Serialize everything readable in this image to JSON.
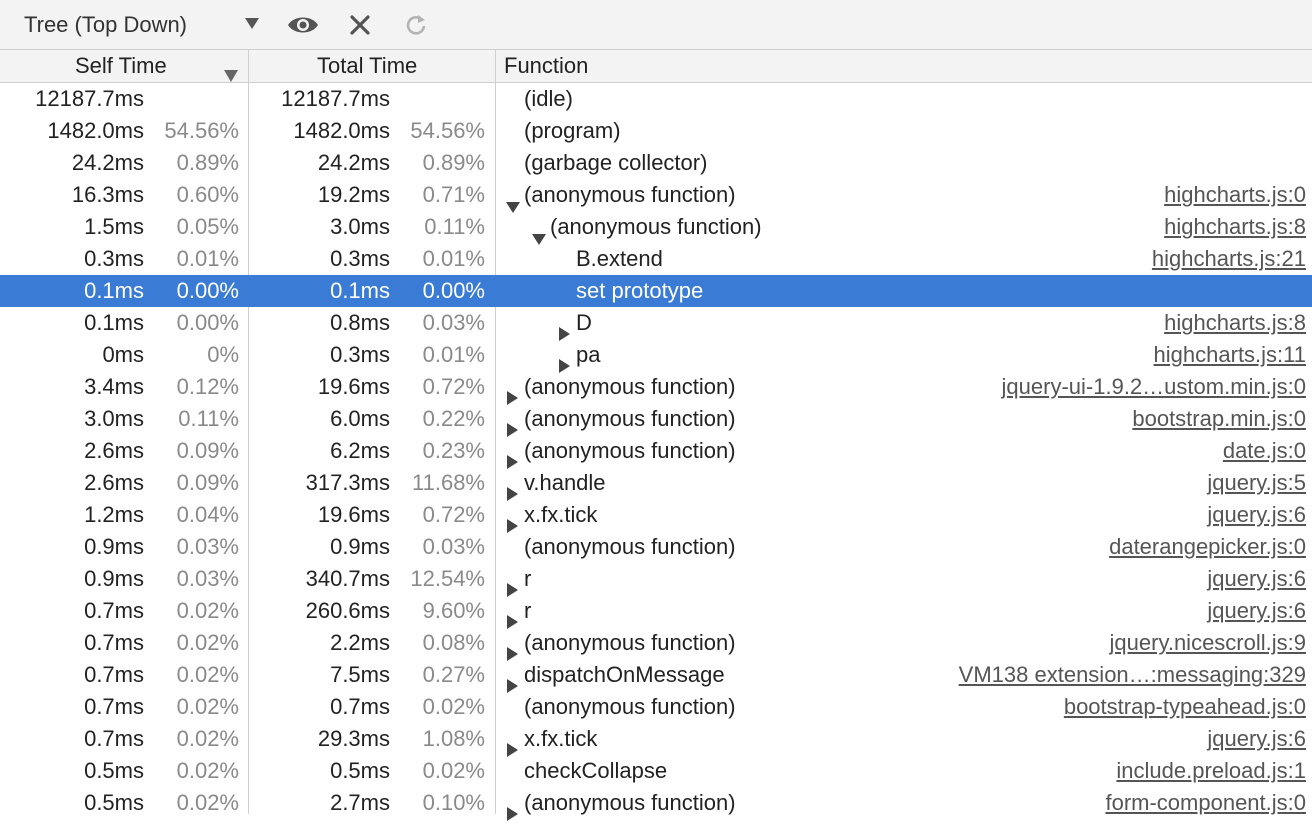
{
  "toolbar": {
    "view_mode": "Tree (Top Down)",
    "icons": [
      "chevron-down-icon",
      "eye-icon",
      "close-icon",
      "reload-icon"
    ]
  },
  "columns": {
    "self_time": "Self Time",
    "total_time": "Total Time",
    "function": "Function"
  },
  "colors": {
    "selection": "#3a7bd5",
    "percent_text": "#8a8a8a",
    "toolbar_bg": "#f3f3f3",
    "divider": "#cfcfcf"
  },
  "rows": [
    {
      "self": "12187.7ms",
      "self_pct": "",
      "total": "12187.7ms",
      "total_pct": "",
      "depth": 0,
      "toggle": "none",
      "name": "(idle)",
      "url": ""
    },
    {
      "self": "1482.0ms",
      "self_pct": "54.56%",
      "total": "1482.0ms",
      "total_pct": "54.56%",
      "depth": 0,
      "toggle": "none",
      "name": "(program)",
      "url": ""
    },
    {
      "self": "24.2ms",
      "self_pct": "0.89%",
      "total": "24.2ms",
      "total_pct": "0.89%",
      "depth": 0,
      "toggle": "none",
      "name": "(garbage collector)",
      "url": ""
    },
    {
      "self": "16.3ms",
      "self_pct": "0.60%",
      "total": "19.2ms",
      "total_pct": "0.71%",
      "depth": 0,
      "toggle": "expanded",
      "name": "(anonymous function)",
      "url": "highcharts.js:0"
    },
    {
      "self": "1.5ms",
      "self_pct": "0.05%",
      "total": "3.0ms",
      "total_pct": "0.11%",
      "depth": 1,
      "toggle": "expanded",
      "name": "(anonymous function)",
      "url": "highcharts.js:8"
    },
    {
      "self": "0.3ms",
      "self_pct": "0.01%",
      "total": "0.3ms",
      "total_pct": "0.01%",
      "depth": 2,
      "toggle": "none",
      "name": "B.extend",
      "url": "highcharts.js:21"
    },
    {
      "self": "0.1ms",
      "self_pct": "0.00%",
      "total": "0.1ms",
      "total_pct": "0.00%",
      "depth": 2,
      "toggle": "none",
      "name": "set prototype",
      "url": "",
      "selected": true
    },
    {
      "self": "0.1ms",
      "self_pct": "0.00%",
      "total": "0.8ms",
      "total_pct": "0.03%",
      "depth": 2,
      "toggle": "collapsed",
      "name": "D",
      "url": "highcharts.js:8"
    },
    {
      "self": "0ms",
      "self_pct": "0%",
      "total": "0.3ms",
      "total_pct": "0.01%",
      "depth": 2,
      "toggle": "collapsed",
      "name": "pa",
      "url": "highcharts.js:11"
    },
    {
      "self": "3.4ms",
      "self_pct": "0.12%",
      "total": "19.6ms",
      "total_pct": "0.72%",
      "depth": 0,
      "toggle": "collapsed",
      "name": "(anonymous function)",
      "url": "jquery-ui-1.9.2…ustom.min.js:0"
    },
    {
      "self": "3.0ms",
      "self_pct": "0.11%",
      "total": "6.0ms",
      "total_pct": "0.22%",
      "depth": 0,
      "toggle": "collapsed",
      "name": "(anonymous function)",
      "url": "bootstrap.min.js:0"
    },
    {
      "self": "2.6ms",
      "self_pct": "0.09%",
      "total": "6.2ms",
      "total_pct": "0.23%",
      "depth": 0,
      "toggle": "collapsed",
      "name": "(anonymous function)",
      "url": "date.js:0"
    },
    {
      "self": "2.6ms",
      "self_pct": "0.09%",
      "total": "317.3ms",
      "total_pct": "11.68%",
      "depth": 0,
      "toggle": "collapsed",
      "name": "v.handle",
      "url": "jquery.js:5"
    },
    {
      "self": "1.2ms",
      "self_pct": "0.04%",
      "total": "19.6ms",
      "total_pct": "0.72%",
      "depth": 0,
      "toggle": "collapsed",
      "name": "x.fx.tick",
      "url": "jquery.js:6"
    },
    {
      "self": "0.9ms",
      "self_pct": "0.03%",
      "total": "0.9ms",
      "total_pct": "0.03%",
      "depth": 0,
      "toggle": "none",
      "name": "(anonymous function)",
      "url": "daterangepicker.js:0"
    },
    {
      "self": "0.9ms",
      "self_pct": "0.03%",
      "total": "340.7ms",
      "total_pct": "12.54%",
      "depth": 0,
      "toggle": "collapsed",
      "name": "r",
      "url": "jquery.js:6"
    },
    {
      "self": "0.7ms",
      "self_pct": "0.02%",
      "total": "260.6ms",
      "total_pct": "9.60%",
      "depth": 0,
      "toggle": "collapsed",
      "name": "r",
      "url": "jquery.js:6"
    },
    {
      "self": "0.7ms",
      "self_pct": "0.02%",
      "total": "2.2ms",
      "total_pct": "0.08%",
      "depth": 0,
      "toggle": "collapsed",
      "name": "(anonymous function)",
      "url": "jquery.nicescroll.js:9"
    },
    {
      "self": "0.7ms",
      "self_pct": "0.02%",
      "total": "7.5ms",
      "total_pct": "0.27%",
      "depth": 0,
      "toggle": "collapsed",
      "name": "dispatchOnMessage",
      "url": "VM138 extension…:messaging:329"
    },
    {
      "self": "0.7ms",
      "self_pct": "0.02%",
      "total": "0.7ms",
      "total_pct": "0.02%",
      "depth": 0,
      "toggle": "none",
      "name": "(anonymous function)",
      "url": "bootstrap-typeahead.js:0"
    },
    {
      "self": "0.7ms",
      "self_pct": "0.02%",
      "total": "29.3ms",
      "total_pct": "1.08%",
      "depth": 0,
      "toggle": "collapsed",
      "name": "x.fx.tick",
      "url": "jquery.js:6"
    },
    {
      "self": "0.5ms",
      "self_pct": "0.02%",
      "total": "0.5ms",
      "total_pct": "0.02%",
      "depth": 0,
      "toggle": "none",
      "name": "checkCollapse",
      "url": "include.preload.js:1"
    },
    {
      "self": "0.5ms",
      "self_pct": "0.02%",
      "total": "2.7ms",
      "total_pct": "0.10%",
      "depth": 0,
      "toggle": "collapsed",
      "name": "(anonymous function)",
      "url": "form-component.js:0"
    }
  ]
}
